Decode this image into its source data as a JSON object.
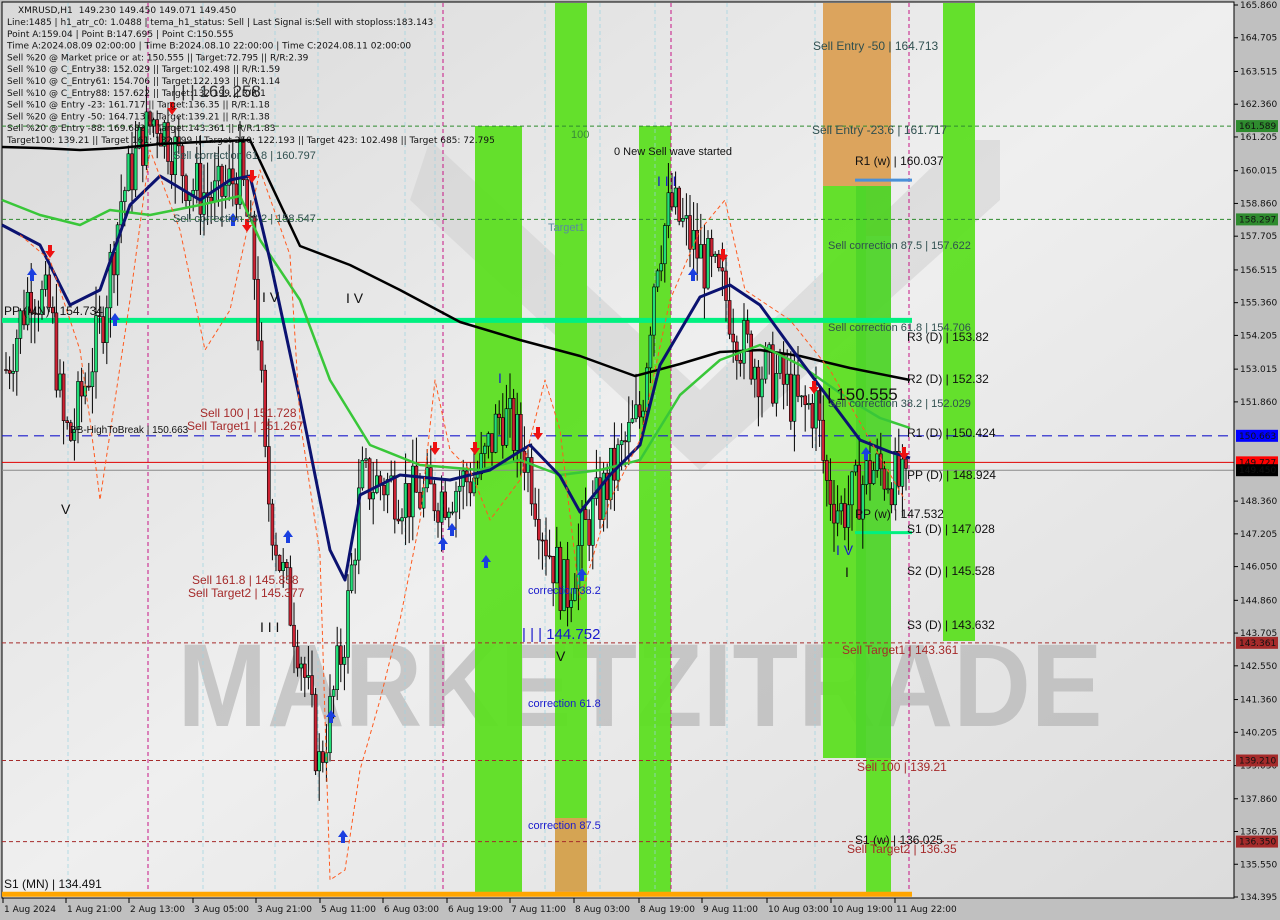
{
  "chart_data": {
    "type": "candlestick",
    "symbol": "XMRUSD,H1",
    "ohlc_header": "149.230 149.450 149.071 149.450",
    "info_lines": [
      "Line:1485 | h1_atr_c0: 1.0488 | tema_h1_status: Sell | Last Signal is:Sell with stoploss:183.143",
      "Point A:159.04 | Point B:147.695 | Point C:150.555",
      "Time A:2024.08.09 02:00:00 | Time B:2024.08.10 22:00:00 | Time C:2024.08.11 02:00:00",
      "Sell %20 @ Market price or at: 150.555 || Target:72.795 || R/R:2.39",
      "Sell %10 @ C_Entry38: 152.029 || Target:102.498 || R/R:1.59",
      "Sell %10 @ C_Entry61: 154.706 || Target:122.193 || R/R:1.14",
      "Sell %10 @ C_Entry88: 157.622 || Target:132.199 || R/R:1",
      "Sell %10 @ Entry -23: 161.717 || Target:136.35 || R/R:1.18",
      "Sell %20 @ Entry -50: 164.713 || Target:139.21 || R/R:1.38",
      "Sell %20 @ Entry -88: 169.682 || Target:143.361 || R/R:1.83",
      "Target100: 139.21 || Target 161: 132.199 || Target 250: 122.193 || Target 423: 102.498 || Target 685: 72.795"
    ],
    "ylim": [
      134.395,
      165.86
    ],
    "y_ticks": [
      "165.860",
      "164.705",
      "163.515",
      "162.360",
      "161.205",
      "160.015",
      "158.860",
      "157.705",
      "156.515",
      "155.360",
      "154.205",
      "153.015",
      "151.860",
      "148.360",
      "147.205",
      "146.050",
      "144.860",
      "143.705",
      "142.550",
      "141.360",
      "140.205",
      "139.030",
      "137.860",
      "136.705",
      "135.550",
      "134.395"
    ],
    "x_ticks": [
      "1 Aug 2024",
      "1 Aug 21:00",
      "2 Aug 13:00",
      "3 Aug 05:00",
      "3 Aug 21:00",
      "5 Aug 11:00",
      "6 Aug 03:00",
      "6 Aug 19:00",
      "7 Aug 11:00",
      "8 Aug 03:00",
      "8 Aug 19:00",
      "9 Aug 11:00",
      "10 Aug 03:00",
      "10 Aug 19:00",
      "11 Aug 22:00"
    ],
    "price_badges": [
      {
        "value": "161.589",
        "color": "#2e8b2e"
      },
      {
        "value": "158.297",
        "color": "#2e8b2e"
      },
      {
        "value": "150.663",
        "color": "#0000ff"
      },
      {
        "value": "149.727",
        "color": "#ff0000"
      },
      {
        "value": "149.450",
        "color": "#000000"
      },
      {
        "value": "143.361",
        "color": "#a52a2a"
      },
      {
        "value": "139.210",
        "color": "#a52a2a"
      },
      {
        "value": "136.350",
        "color": "#a52a2a"
      }
    ],
    "levels": [
      {
        "name": "Sell Entry -50",
        "value": 164.713,
        "label": "Sell Entry -50 | 164.713"
      },
      {
        "name": "Sell Entry -23.6",
        "value": 161.717,
        "label": "Sell Entry -23.6 | 161.717"
      },
      {
        "name": "R1 (w)",
        "value": 160.037,
        "label": "R1 (w) | 160.037"
      },
      {
        "name": "Sell correction 87.5",
        "value": 157.622,
        "label": "Sell correction 87.5 | 157.622"
      },
      {
        "name": "Sell correction 61.8",
        "value": 154.706,
        "label": "Sell correction 61.8 | 154.706"
      },
      {
        "name": "R3 (D)",
        "value": 153.82,
        "label": "R3 (D) | 153.82"
      },
      {
        "name": "R2 (D)",
        "value": 152.32,
        "label": "R2 (D) | 152.32"
      },
      {
        "name": "Sell correction 38.2",
        "value": 152.029,
        "label": "Sell correction 38.2 | 152.029"
      },
      {
        "name": "Point C",
        "value": 150.555,
        "label": "| | 150.555"
      },
      {
        "name": "R1 (D)",
        "value": 150.424,
        "label": "R1 (D) | 150.424"
      },
      {
        "name": "PP (D)",
        "value": 148.924,
        "label": "PP (D) | 148.924"
      },
      {
        "name": "PP (w)",
        "value": 147.532,
        "label": "PP (w) | 147.532"
      },
      {
        "name": "S1 (D)",
        "value": 147.028,
        "label": "S1 (D) | 147.028"
      },
      {
        "name": "S2 (D)",
        "value": 145.528,
        "label": "S2 (D) | 145.528"
      },
      {
        "name": "S3 (D)",
        "value": 143.632,
        "label": "S3 (D) | 143.632"
      },
      {
        "name": "Sell Target1",
        "value": 143.361,
        "label": "Sell Target1 | 143.361"
      },
      {
        "name": "Sell 100",
        "value": 139.21,
        "label": "Sell 100 | 139.21"
      },
      {
        "name": "S1 (w)",
        "value": 136.025,
        "label": "S1 (w) | 136.025"
      },
      {
        "name": "Sell Target2",
        "value": 136.35,
        "label": "Sell Target2 | 136.35"
      },
      {
        "name": "PP (MN)",
        "value": 154.734,
        "label": "PP (MN) | 154.734"
      },
      {
        "name": "S1 (MN)",
        "value": 134.491,
        "label": "S1 (MN) | 134.491"
      },
      {
        "name": "HighToBreak",
        "value": 150.663,
        "label": "BB-HighToBreak | 150.663"
      }
    ],
    "old_labels": [
      {
        "label": "Sell correction 61.8 | 160.797"
      },
      {
        "label": "Sell correction 38.2 | 158.547"
      },
      {
        "label": "Sell 100 | 151.728"
      },
      {
        "label": "Sell Target1 | 151.267"
      },
      {
        "label": "Sell 161.8 | 145.838"
      },
      {
        "label": "Sell Target2 | 145.377"
      },
      {
        "label": "| | | 161.258"
      },
      {
        "label": "| | | 144.752"
      },
      {
        "label": "correction 38.2"
      },
      {
        "label": "correction 61.8"
      },
      {
        "label": "correction 87.5"
      },
      {
        "label": "100"
      },
      {
        "label": "Target1"
      },
      {
        "label": "0 New Sell wave started"
      }
    ],
    "wave_labels": [
      "V",
      "I V",
      "I V",
      "I I I",
      "V",
      "I I I",
      "I",
      "I V",
      "I"
    ],
    "watermark": "MARKETZITRADE",
    "grid": false
  }
}
